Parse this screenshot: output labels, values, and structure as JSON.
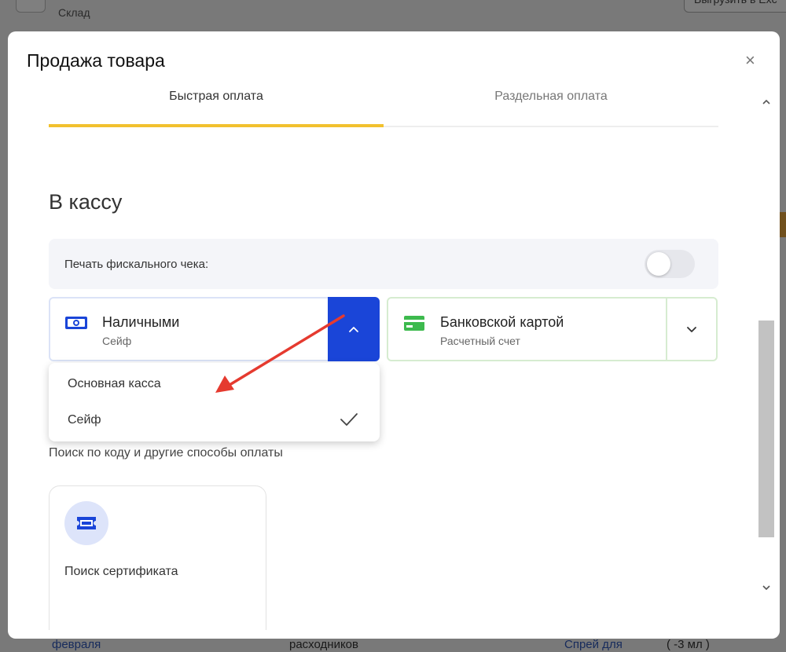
{
  "background": {
    "header_subtitle": "Склад",
    "header_button": "Выгрузить в Exc",
    "bottom_row": {
      "month_link": "февраля",
      "text": "расходников",
      "item_link": "Спрей для",
      "qty": "( -3 мл )"
    }
  },
  "modal": {
    "title": "Продажа товара",
    "close_label": "×",
    "tabs": [
      {
        "label": "Быстрая оплата",
        "active": true
      },
      {
        "label": "Раздельная оплата",
        "active": false
      }
    ],
    "section_title": "В кассу",
    "fiscal_label": "Печать фискального чека:",
    "fiscal_enabled": false,
    "payment_methods": [
      {
        "name": "Наличными",
        "subtitle": "Сейф",
        "icon": "cash-icon",
        "expanded": true
      },
      {
        "name": "Банковской картой",
        "subtitle": "Расчетный счет",
        "icon": "card-icon",
        "expanded": false
      }
    ],
    "cash_options": [
      {
        "label": "Основная касса",
        "selected": false
      },
      {
        "label": "Сейф",
        "selected": true
      }
    ],
    "other_methods_label": "Поиск по коду и другие способы оплаты",
    "certificate_label": "Поиск сертификата"
  },
  "colors": {
    "active_tab": "#f2c12e",
    "cash_accent": "#1a45d8",
    "card_accent": "#3dba4e",
    "annotation_arrow": "#e53a2f"
  }
}
